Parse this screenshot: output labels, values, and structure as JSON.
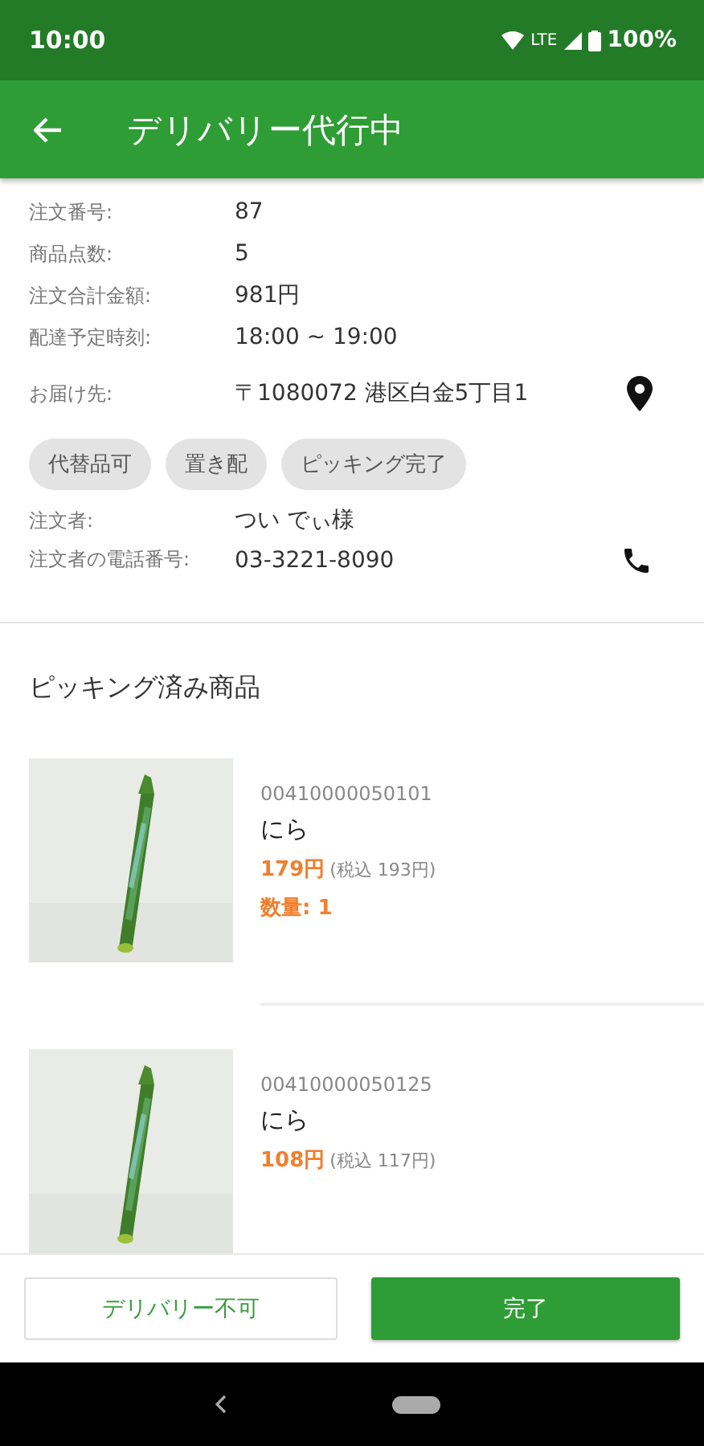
{
  "status_bar": {
    "time": "10:00",
    "network": "LTE",
    "battery": "100%"
  },
  "app_bar": {
    "title": "デリバリー代行中"
  },
  "order_info": [
    {
      "label": "注文番号:",
      "value": "87"
    },
    {
      "label": "商品点数:",
      "value": "5"
    },
    {
      "label": "注文合計金額:",
      "value": "981円"
    },
    {
      "label": "配達予定時刻:",
      "value": "18:00 ~ 19:00"
    }
  ],
  "address": {
    "label": "お届け先:",
    "value": "〒1080072 港区白金5丁目1"
  },
  "tags": [
    "代替品可",
    "置き配",
    "ピッキング完了"
  ],
  "customer": {
    "label": "注文者:",
    "value": "つい でぃ様"
  },
  "phone": {
    "label": "注文者の電話番号:",
    "value": "03-3221-8090"
  },
  "section_title": "ピッキング済み商品",
  "products": [
    {
      "code": "00410000050101",
      "name": "にら",
      "price": "179円",
      "tax_price": "(税込 193円)",
      "quantity": "数量: 1"
    },
    {
      "code": "00410000050125",
      "name": "にら",
      "price": "108円",
      "tax_price": "(税込 117円)"
    }
  ],
  "buttons": {
    "secondary": "デリバリー不可",
    "primary": "完了"
  }
}
